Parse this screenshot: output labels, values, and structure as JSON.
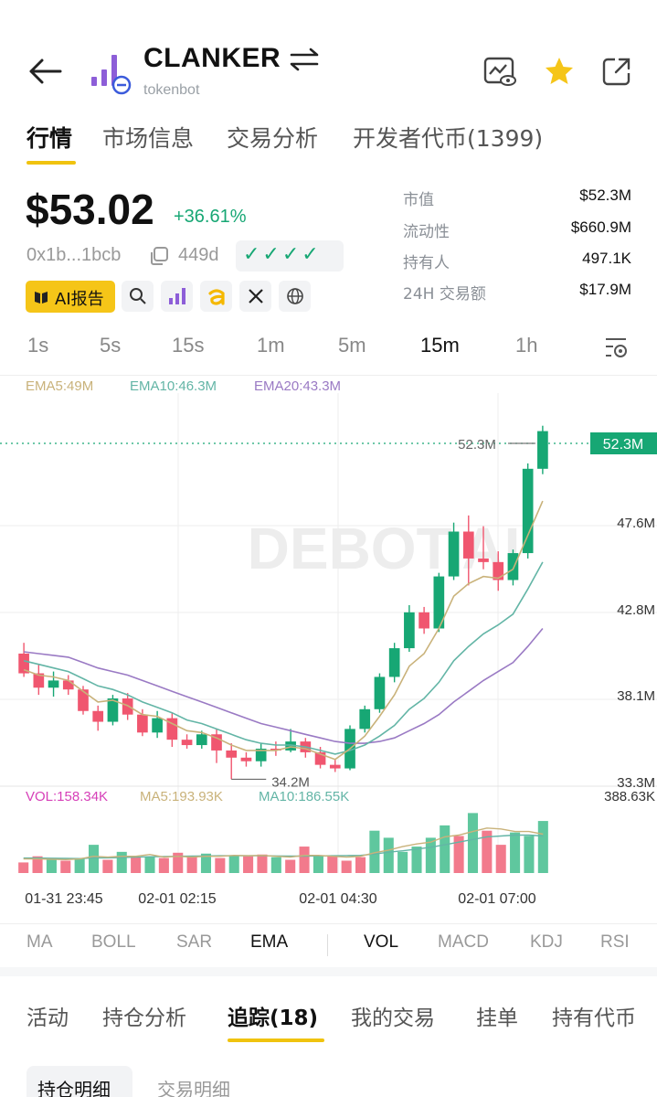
{
  "header": {
    "back_icon": "arrow-left-icon",
    "token_name": "CLANKER",
    "swap_icon": "swap-arrows-icon",
    "subtitle": "tokenbot",
    "actions": [
      "chart-watch-icon",
      "star-icon",
      "share-icon"
    ]
  },
  "top_tabs": [
    {
      "label": "行情",
      "active": true
    },
    {
      "label": "市场信息",
      "active": false
    },
    {
      "label": "交易分析",
      "active": false
    },
    {
      "label": "开发者代币(1399)",
      "active": false
    }
  ],
  "price": {
    "value": "$53.02",
    "change": "+36.61%",
    "address": "0x1b...1bcb",
    "age": "449d",
    "checks": "✓✓✓✓"
  },
  "stats": [
    {
      "label": "市值",
      "value": "$52.3M"
    },
    {
      "label": "流动性",
      "value": "$660.9M"
    },
    {
      "label": "持有人",
      "value": "497.1K"
    },
    {
      "label": "24H 交易额",
      "value": "$17.9M"
    }
  ],
  "chips": {
    "ai_report": "AI报告",
    "icons": [
      "search-icon",
      "bars-logo-icon",
      "a-logo-icon",
      "x-logo-icon",
      "globe-icon"
    ]
  },
  "timeframes": [
    {
      "label": "1s",
      "active": false
    },
    {
      "label": "5s",
      "active": false
    },
    {
      "label": "15s",
      "active": false
    },
    {
      "label": "1m",
      "active": false
    },
    {
      "label": "5m",
      "active": false
    },
    {
      "label": "15m",
      "active": true
    },
    {
      "label": "1h",
      "active": false
    }
  ],
  "chart_legend": {
    "ema5": "EMA5:49M",
    "ema10": "EMA10:46.3M",
    "ema20": "EMA20:43.3M",
    "vol": "VOL:158.34K",
    "ma5": "MA5:193.93K",
    "ma10": "MA10:186.55K"
  },
  "chart_labels": {
    "watermark": "DEBOT.AI",
    "current_price_tag": "52.3M",
    "last_label": "52.3M",
    "low_label": "34.2M",
    "vol_max": "388.63K"
  },
  "chart_data": {
    "type": "candlestick",
    "y_ticks": [
      "47.6M",
      "42.8M",
      "38.1M",
      "33.3M"
    ],
    "x_ticks": [
      "01-31 23:45",
      "02-01 02:15",
      "02-01 04:30",
      "02-01 07:00"
    ],
    "ylim": [
      33.3,
      54.7
    ],
    "candles": [
      {
        "o": 41.2,
        "c": 40.1,
        "h": 41.8,
        "l": 39.9
      },
      {
        "o": 40.1,
        "c": 39.3,
        "h": 40.6,
        "l": 38.9
      },
      {
        "o": 39.3,
        "c": 39.7,
        "h": 40.2,
        "l": 38.8
      },
      {
        "o": 39.7,
        "c": 39.2,
        "h": 40.0,
        "l": 38.9
      },
      {
        "o": 39.2,
        "c": 38.0,
        "h": 39.4,
        "l": 37.8
      },
      {
        "o": 38.0,
        "c": 37.4,
        "h": 38.3,
        "l": 36.9
      },
      {
        "o": 37.4,
        "c": 38.7,
        "h": 38.9,
        "l": 37.2
      },
      {
        "o": 38.7,
        "c": 37.8,
        "h": 39.0,
        "l": 37.5
      },
      {
        "o": 37.8,
        "c": 36.8,
        "h": 38.1,
        "l": 36.6
      },
      {
        "o": 36.8,
        "c": 37.6,
        "h": 38.0,
        "l": 36.5
      },
      {
        "o": 37.6,
        "c": 36.4,
        "h": 37.9,
        "l": 36.0
      },
      {
        "o": 36.4,
        "c": 36.1,
        "h": 36.7,
        "l": 35.9
      },
      {
        "o": 36.1,
        "c": 36.7,
        "h": 36.9,
        "l": 35.9
      },
      {
        "o": 36.7,
        "c": 35.8,
        "h": 37.0,
        "l": 35.1
      },
      {
        "o": 35.8,
        "c": 35.4,
        "h": 36.2,
        "l": 34.2
      },
      {
        "o": 35.4,
        "c": 35.2,
        "h": 35.7,
        "l": 34.9
      },
      {
        "o": 35.2,
        "c": 35.9,
        "h": 36.2,
        "l": 34.9
      },
      {
        "o": 35.9,
        "c": 35.8,
        "h": 36.3,
        "l": 35.5
      },
      {
        "o": 35.8,
        "c": 36.3,
        "h": 37.0,
        "l": 35.7
      },
      {
        "o": 36.3,
        "c": 35.7,
        "h": 36.5,
        "l": 35.4
      },
      {
        "o": 35.7,
        "c": 35.0,
        "h": 36.0,
        "l": 34.8
      },
      {
        "o": 35.0,
        "c": 34.8,
        "h": 35.3,
        "l": 34.6
      },
      {
        "o": 34.8,
        "c": 37.0,
        "h": 37.2,
        "l": 34.7
      },
      {
        "o": 37.0,
        "c": 38.1,
        "h": 38.3,
        "l": 36.8
      },
      {
        "o": 38.1,
        "c": 39.9,
        "h": 40.1,
        "l": 37.9
      },
      {
        "o": 39.9,
        "c": 41.5,
        "h": 41.8,
        "l": 39.6
      },
      {
        "o": 41.5,
        "c": 43.5,
        "h": 43.9,
        "l": 41.3
      },
      {
        "o": 43.5,
        "c": 42.6,
        "h": 43.8,
        "l": 42.3
      },
      {
        "o": 42.6,
        "c": 45.5,
        "h": 45.7,
        "l": 42.4
      },
      {
        "o": 45.5,
        "c": 48.0,
        "h": 48.5,
        "l": 45.3
      },
      {
        "o": 48.0,
        "c": 46.5,
        "h": 48.9,
        "l": 45.0
      },
      {
        "o": 46.5,
        "c": 46.3,
        "h": 48.3,
        "l": 45.9
      },
      {
        "o": 46.3,
        "c": 45.3,
        "h": 46.9,
        "l": 44.7
      },
      {
        "o": 45.3,
        "c": 46.8,
        "h": 47.0,
        "l": 45.0
      },
      {
        "o": 46.8,
        "c": 51.5,
        "h": 51.8,
        "l": 46.5
      },
      {
        "o": 51.5,
        "c": 53.6,
        "h": 53.9,
        "l": 51.2
      }
    ],
    "ema5": [
      40.3,
      40.0,
      39.9,
      39.7,
      39.1,
      38.5,
      38.6,
      38.3,
      37.8,
      37.7,
      37.3,
      36.9,
      36.8,
      36.5,
      36.1,
      35.8,
      35.8,
      35.8,
      36.0,
      35.9,
      35.6,
      35.3,
      35.9,
      36.6,
      37.7,
      38.9,
      40.5,
      41.2,
      42.6,
      44.4,
      45.1,
      45.5,
      45.4,
      45.9,
      47.8,
      49.7
    ],
    "ema10": [
      40.8,
      40.6,
      40.4,
      40.2,
      39.8,
      39.4,
      39.2,
      38.9,
      38.5,
      38.2,
      37.9,
      37.5,
      37.3,
      37.0,
      36.7,
      36.4,
      36.2,
      36.1,
      36.1,
      36.0,
      35.8,
      35.6,
      35.8,
      36.1,
      36.6,
      37.2,
      38.1,
      38.7,
      39.6,
      40.8,
      41.6,
      42.3,
      42.8,
      43.4,
      44.8,
      46.3
    ],
    "ema20": [
      41.3,
      41.2,
      41.1,
      41.0,
      40.7,
      40.4,
      40.2,
      40.0,
      39.7,
      39.4,
      39.1,
      38.8,
      38.5,
      38.2,
      37.9,
      37.6,
      37.3,
      37.1,
      36.9,
      36.7,
      36.5,
      36.3,
      36.2,
      36.2,
      36.3,
      36.5,
      36.9,
      37.3,
      37.8,
      38.5,
      39.1,
      39.7,
      40.2,
      40.7,
      41.6,
      42.6
    ],
    "volume_ylim": [
      0,
      388.63
    ],
    "volume": [
      60,
      95,
      80,
      70,
      80,
      160,
      75,
      120,
      90,
      95,
      85,
      115,
      90,
      110,
      85,
      100,
      95,
      105,
      90,
      75,
      150,
      95,
      95,
      70,
      90,
      240,
      200,
      120,
      150,
      200,
      270,
      210,
      340,
      240,
      160,
      230,
      210,
      295
    ],
    "volume_up": [
      false,
      false,
      true,
      false,
      true,
      true,
      false,
      true,
      false,
      true,
      false,
      false,
      false,
      true,
      false,
      true,
      false,
      false,
      true,
      false,
      false,
      true,
      false,
      false,
      false,
      true,
      true,
      true,
      true,
      true,
      true,
      false,
      true,
      false,
      false,
      true,
      true,
      true
    ],
    "vol_ma5": [
      80,
      80,
      78,
      76,
      80,
      95,
      90,
      95,
      95,
      105,
      90,
      95,
      90,
      95,
      95,
      100,
      98,
      100,
      95,
      90,
      100,
      100,
      95,
      90,
      95,
      115,
      130,
      150,
      165,
      175,
      205,
      215,
      235,
      255,
      250,
      235,
      235,
      220
    ],
    "vol_ma10": [
      85,
      85,
      84,
      83,
      82,
      86,
      86,
      88,
      90,
      92,
      94,
      95,
      96,
      97,
      98,
      98,
      98,
      98,
      97,
      96,
      96,
      97,
      98,
      99,
      100,
      108,
      118,
      126,
      136,
      146,
      160,
      175,
      190,
      205,
      210,
      215,
      215,
      210
    ]
  },
  "indicators": {
    "main": [
      {
        "label": "MA",
        "active": false
      },
      {
        "label": "BOLL",
        "active": false
      },
      {
        "label": "SAR",
        "active": false
      },
      {
        "label": "EMA",
        "active": true
      }
    ],
    "sub": [
      {
        "label": "VOL",
        "active": true
      },
      {
        "label": "MACD",
        "active": false
      },
      {
        "label": "KDJ",
        "active": false
      },
      {
        "label": "RSI",
        "active": false
      }
    ]
  },
  "bottom_tabs": [
    {
      "label": "活动",
      "active": false
    },
    {
      "label": "持仓分析",
      "active": false
    },
    {
      "label": "追踪(18)",
      "active": true
    },
    {
      "label": "我的交易",
      "active": false
    },
    {
      "label": "挂单",
      "active": false
    },
    {
      "label": "持有代币",
      "active": false
    }
  ],
  "sub_tabs": [
    {
      "label": "持仓明细",
      "active": true
    },
    {
      "label": "交易明细",
      "active": false
    }
  ],
  "colors": {
    "up": "#17a774",
    "down": "#f0566f",
    "vol_up": "#5fc79e",
    "vol_down": "#f27a8c",
    "ema5": "#c9b27a",
    "ema10": "#63b5a6",
    "ema20": "#9a7ac4",
    "accent": "#f0c30f",
    "vol_label": "#d63fb8"
  }
}
